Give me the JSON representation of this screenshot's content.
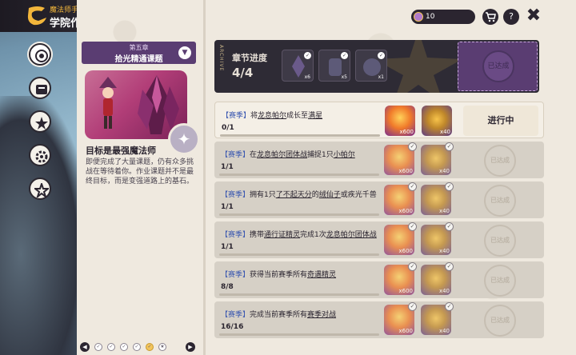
{
  "header": {
    "subtitle": "魔法师手册",
    "title": "学院作业"
  },
  "sidenav": {
    "items": [
      "target-icon",
      "book-icon",
      "star-icon",
      "gear-icon",
      "badge-icon"
    ]
  },
  "chapter": {
    "number": "第五章",
    "name": "拾光精通课题",
    "goal_title": "目标是最强魔法师",
    "goal_text": "即便完成了大量课题，仍有众多挑战在等待着你。作业课题并不是最终目标，而是变强道路上的基石。"
  },
  "progress": {
    "vertical_text": "ARCHIVE",
    "label": "章节进度",
    "value": "4/4",
    "rewards": [
      {
        "icon": "dark-crystal-icon",
        "qty": "x6"
      },
      {
        "icon": "dark-lantern-icon",
        "qty": "x5"
      },
      {
        "icon": "dark-orb-icon",
        "qty": "x1"
      }
    ],
    "stamp": "已达成"
  },
  "tasks": [
    {
      "tag": "【赛季】",
      "pre": "将",
      "hl1": "龙息帕尔",
      "mid": "成长至",
      "hl2": "满星",
      "post": "",
      "count": "0/1",
      "progress": 0.0,
      "status": "进行中",
      "state": "active"
    },
    {
      "tag": "【赛季】",
      "pre": "在",
      "hl1": "龙息帕尔团体战",
      "mid": "捕捉1只",
      "hl2": "小帕尔",
      "post": "",
      "count": "1/1",
      "progress": 1.0,
      "status": "已达成",
      "state": "done"
    },
    {
      "tag": "【赛季】",
      "pre": "拥有1只",
      "hl1": "了不起天分",
      "mid": "的",
      "hl2": "绒仙子",
      "post": "或疾光千兽",
      "count": "1/1",
      "progress": 1.0,
      "status": "已达成",
      "state": "done"
    },
    {
      "tag": "【赛季】",
      "pre": "携带",
      "hl1": "通行证精灵",
      "mid": "完成1次",
      "hl2": "龙息帕尔团体战",
      "post": "",
      "count": "1/1",
      "progress": 1.0,
      "status": "已达成",
      "state": "done"
    },
    {
      "tag": "【赛季】",
      "pre": "获得当前赛季所有",
      "hl1": "奇遇精灵",
      "mid": "",
      "hl2": "",
      "post": "",
      "count": "8/8",
      "progress": 1.0,
      "status": "已达成",
      "state": "done"
    },
    {
      "tag": "【赛季】",
      "pre": "完成当前赛季所有",
      "hl1": "赛季对战",
      "mid": "",
      "hl2": "",
      "post": "",
      "count": "16/16",
      "progress": 1.0,
      "status": "已达成",
      "state": "done"
    }
  ],
  "task_rewards": {
    "fire_qty": "x600",
    "orb_qty": "x40"
  },
  "status_colors": {
    "tag": "#3a57b0",
    "active_bg": "#f4efe6",
    "done_bg": "#d6d0c6"
  },
  "topbar": {
    "currency": "10"
  }
}
